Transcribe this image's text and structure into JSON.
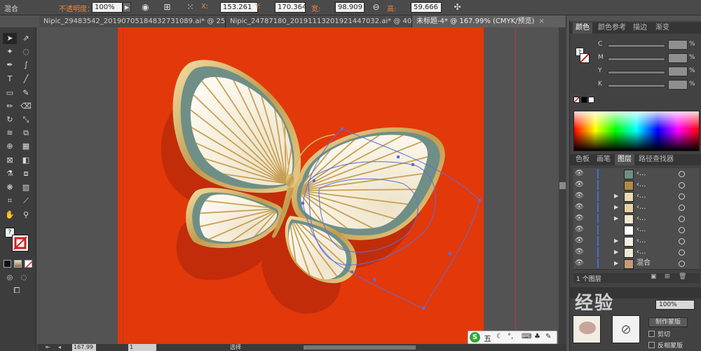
{
  "control_bar": {
    "object_label": "混合",
    "opacity_label": "不透明度：",
    "opacity_value": "100%",
    "x_label": "X:",
    "x_value": "153.261",
    "y_label": "Y:",
    "y_value": "170.364",
    "w_label": "宽:",
    "w_value": "98.909",
    "h_label": "高:",
    "h_value": "59.666"
  },
  "tabs": [
    {
      "label": "Nipic_29483542_20190705184832731089.ai* @ 25..."
    },
    {
      "label": "Nipic_24787180_20191113201921447032.ai* @ 400..."
    },
    {
      "label": "未标题-4* @ 167.99% (CMYK/预览)"
    }
  ],
  "color_panel": {
    "tabs": [
      "颜色",
      "颜色参考",
      "描边",
      "渐变"
    ],
    "sliders": [
      {
        "label": "C",
        "unit": "%"
      },
      {
        "label": "M",
        "unit": "%"
      },
      {
        "label": "Y",
        "unit": "%"
      },
      {
        "label": "K",
        "unit": "%"
      }
    ]
  },
  "layers_panel": {
    "tabs": [
      "色板",
      "画笔",
      "图层",
      "路径查找器"
    ],
    "rows": [
      {
        "name": "‹..."
      },
      {
        "name": "‹..."
      },
      {
        "name": "‹..."
      },
      {
        "name": "‹..."
      },
      {
        "name": "‹..."
      },
      {
        "name": "‹..."
      },
      {
        "name": "‹..."
      },
      {
        "name": "‹..."
      },
      {
        "name": "混合"
      }
    ],
    "count_label": "1 个图层"
  },
  "transparency_panel": {
    "opacity_value": "100%",
    "make_mask_label": "制作蒙版",
    "clip_label": "剪切",
    "invert_label": "反相蒙版"
  },
  "status": {
    "zoom": "167.99",
    "page": "1",
    "tool": "选择"
  },
  "ime": {
    "label": "五"
  },
  "watermark": {
    "text": "经验"
  },
  "colors": {
    "artboard": "#e3380a",
    "wing_green": "#6f8f86",
    "wing_cream": "#f5efe2",
    "gold": "#c8a055",
    "path_blue": "#5b6fd8"
  }
}
